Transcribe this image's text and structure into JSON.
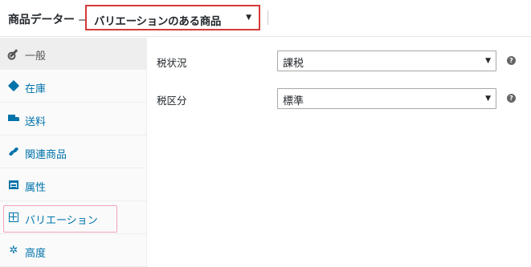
{
  "header": {
    "title": "商品データー",
    "dash": "—",
    "product_type": "バリエーションのある商品"
  },
  "sidebar": {
    "items": [
      {
        "label": "一般",
        "icon": "wrench-icon"
      },
      {
        "label": "在庫",
        "icon": "tag-icon"
      },
      {
        "label": "送料",
        "icon": "truck-icon"
      },
      {
        "label": "関連商品",
        "icon": "link-icon"
      },
      {
        "label": "属性",
        "icon": "list-icon"
      },
      {
        "label": "バリエーション",
        "icon": "grid-icon"
      },
      {
        "label": "高度",
        "icon": "gear-icon"
      }
    ]
  },
  "main": {
    "tax_status": {
      "label": "税状況",
      "value": "課税"
    },
    "tax_class": {
      "label": "税区分",
      "value": "標準"
    }
  },
  "colors": {
    "accent_link": "#0073aa",
    "highlight_red": "#d43a3a",
    "highlight_pink": "#f0a4b6"
  }
}
